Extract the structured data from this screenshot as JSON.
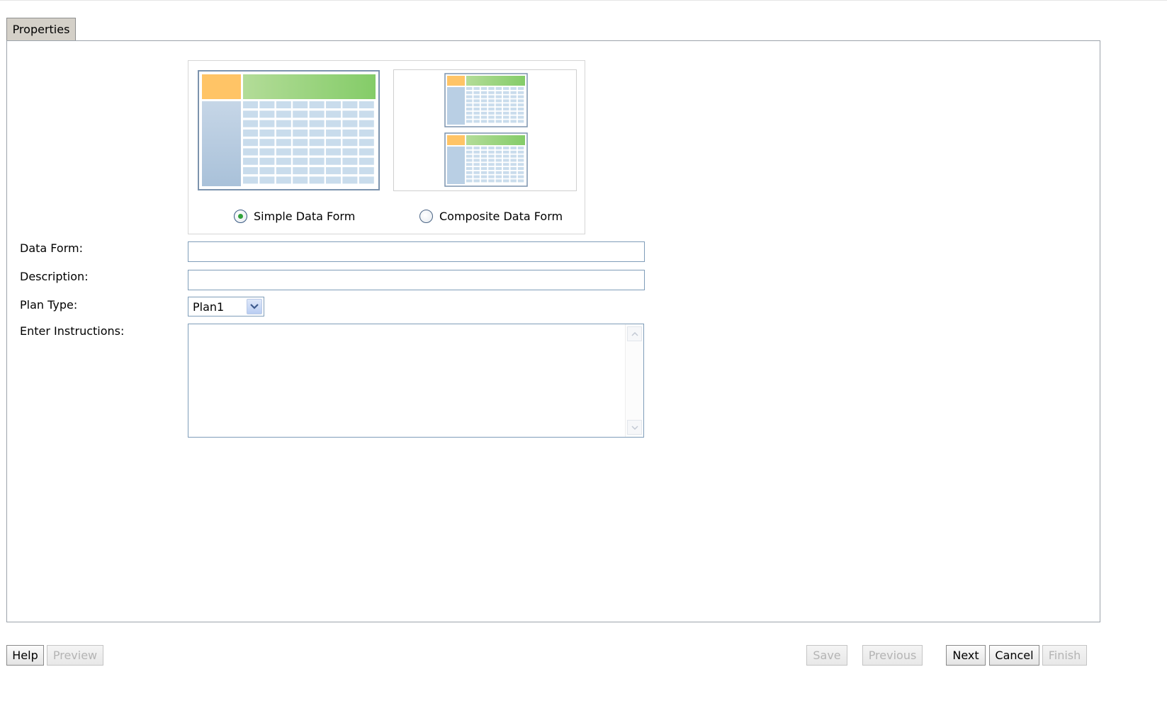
{
  "tabs": [
    {
      "label": "Properties",
      "active": true
    }
  ],
  "form_type": {
    "options": [
      {
        "label": "Simple Data Form",
        "selected": true
      },
      {
        "label": "Composite Data Form",
        "selected": false
      }
    ]
  },
  "fields": {
    "data_form": {
      "label": "Data Form:",
      "value": ""
    },
    "description": {
      "label": "Description:",
      "value": ""
    },
    "plan_type": {
      "label": "Plan Type:",
      "value": "Plan1"
    },
    "instructions": {
      "label": "Enter Instructions:",
      "value": ""
    }
  },
  "buttons": {
    "help": {
      "label": "Help",
      "enabled": true
    },
    "preview": {
      "label": "Preview",
      "enabled": false
    },
    "save": {
      "label": "Save",
      "enabled": false
    },
    "previous": {
      "label": "Previous",
      "enabled": false
    },
    "next": {
      "label": "Next",
      "enabled": true
    },
    "cancel": {
      "label": "Cancel",
      "enabled": true
    },
    "finish": {
      "label": "Finish",
      "enabled": false
    }
  },
  "colors": {
    "accent_orange": "#ffc466",
    "accent_green": "#8fd279",
    "grid_blue": "#c9dcec",
    "side_blue": "#b7cde2",
    "radio_selected": "#2fa13a",
    "disabled_text": "#b4b4b4"
  }
}
